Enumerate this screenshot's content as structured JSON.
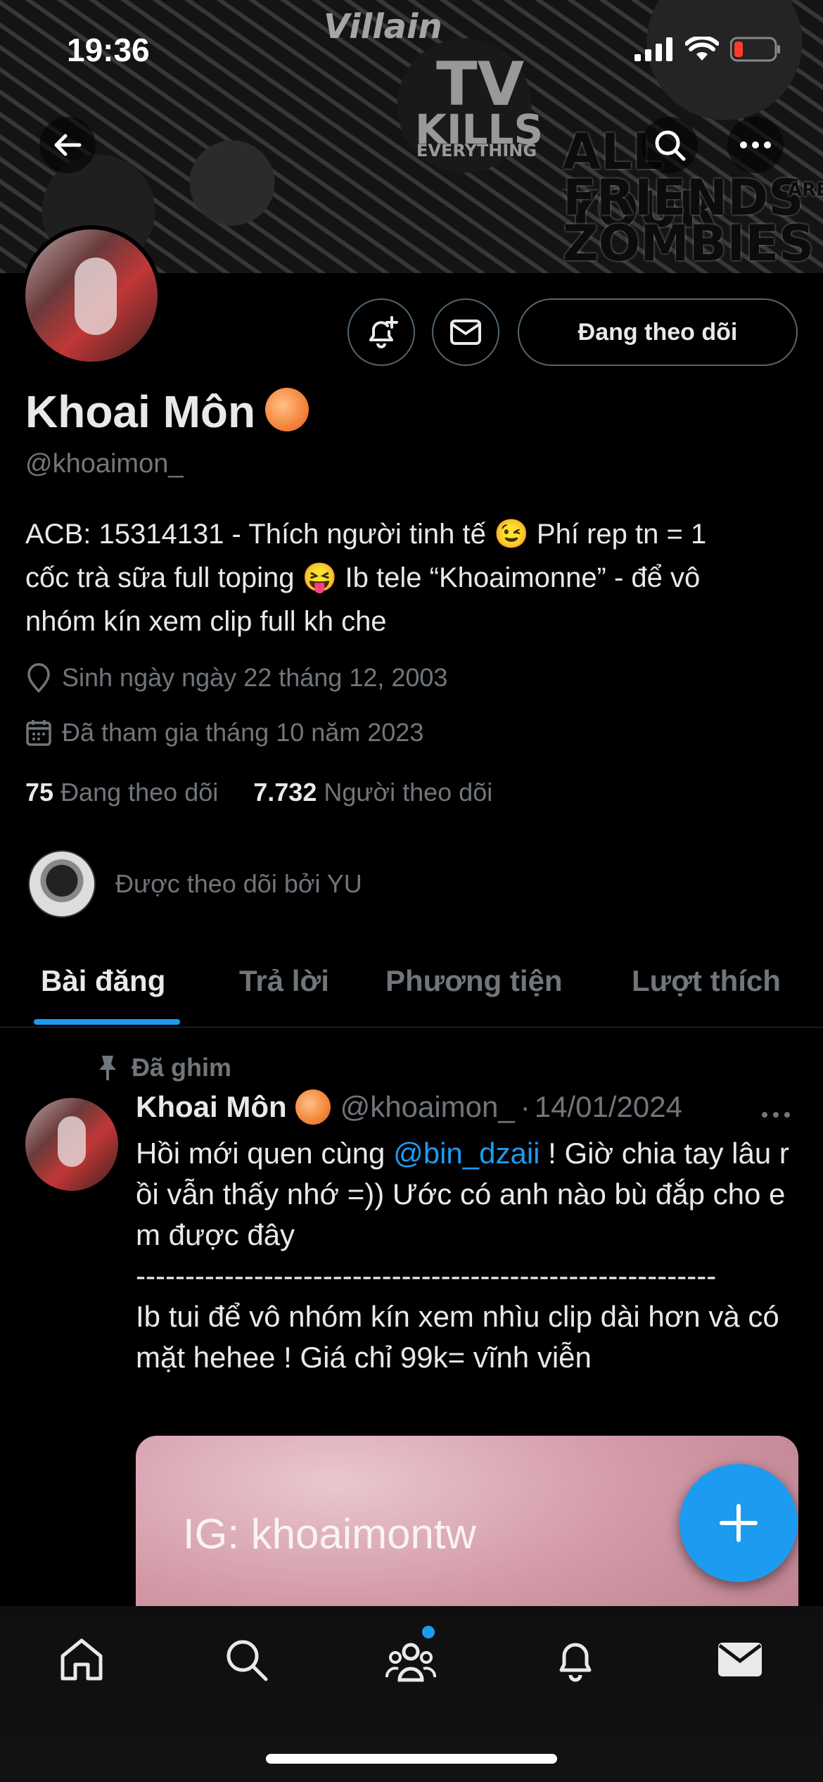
{
  "status_bar": {
    "time": "19:36"
  },
  "banner": {
    "texts": {
      "villain": "Villain",
      "tv": "TV",
      "kills": "KILLS",
      "everything": "EVERYTHING",
      "all_your": "ALL YOUR",
      "friends": "FRIENDS",
      "are": "ARE",
      "zombies": "ZOMBIES"
    }
  },
  "profile": {
    "name": "Khoai Môn",
    "handle": "@khoaimon_",
    "follow_button": "Đang theo dõi",
    "bio_lines": [
      "ACB: 15314131 - Thích người tinh tế 😉 Phí rep tn = 1",
      "cốc trà sữa full toping 😝 Ib tele “Khoaimonne” - để vô",
      "nhóm kín xem clip full kh che"
    ],
    "birthday": "Sinh ngày ngày 22 tháng 12, 2003",
    "joined": "Đã tham gia tháng 10 năm 2023",
    "following_count": "75",
    "following_label": "Đang theo dõi",
    "followers_count": "7.732",
    "followers_label": "Người theo dõi",
    "followed_by": "Được theo dõi bởi YU"
  },
  "tabs": [
    "Bài đăng",
    "Trả lời",
    "Phương tiện",
    "Lượt thích"
  ],
  "post": {
    "pinned_label": "Đã ghim",
    "author_name": "Khoai Môn",
    "author_handle": "@khoaimon_",
    "separator": "·",
    "date": "14/01/2024",
    "text_before_mention": "Hồi mới quen cùng ",
    "mention": "@bin_dzaii",
    "text_after_mention": " ! Giờ chia tay lâu rồi vẫn thấy nhớ =)) Ước có anh nào bù đắp cho em được đây",
    "divider": "-----------------------------------------------------------",
    "text_second": "Ib tui để vô nhóm kín xem nhìu clip dài hơn và có mặt hehee ! Giá chỉ 99k= vĩnh viễn",
    "media_caption": "IG: khoaimontw"
  },
  "colors": {
    "accent": "#1d9bf0",
    "muted": "#71767b",
    "text": "#e7e9ea",
    "peach": "#f4843a"
  },
  "icons": [
    "back-arrow-icon",
    "search-icon",
    "more-icon",
    "notification-add-icon",
    "mail-icon",
    "location-icon",
    "calendar-icon",
    "pin-icon",
    "compose-plus-icon",
    "home-icon",
    "communities-icon",
    "bell-icon",
    "messages-icon"
  ]
}
